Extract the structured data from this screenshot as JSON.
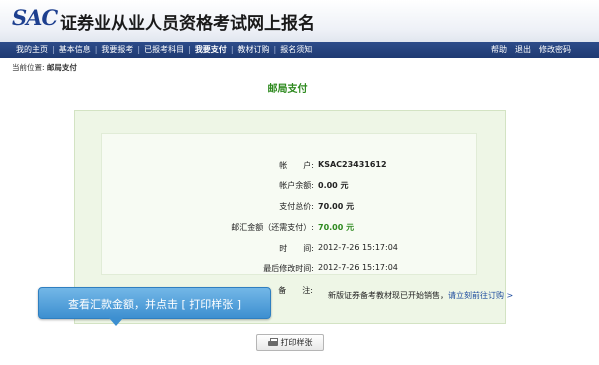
{
  "header": {
    "logo": "SAC",
    "title": "证券业从业人员资格考试网上报名"
  },
  "nav": {
    "left": [
      "我的主页",
      "基本信息",
      "我要报考",
      "已报考科目",
      "我要支付",
      "教材订购",
      "报名须知"
    ],
    "active_index": 4,
    "right": [
      "帮助",
      "退出",
      "修改密码"
    ]
  },
  "breadcrumb": {
    "label": "当前位置:",
    "current": "邮局支付"
  },
  "page_title": "邮局支付",
  "details": [
    {
      "label": "帐　　户:",
      "value": "KSAC23431612"
    },
    {
      "label": "帐户余额:",
      "value": "0.00 元"
    },
    {
      "label": "支付总价:",
      "value": "70.00 元"
    },
    {
      "label": "邮汇金额（还需支付）:",
      "value": "70.00 元"
    },
    {
      "label": "时　　间:",
      "value": "2012-7-26 15:17:04"
    },
    {
      "label": "最后修改时间:",
      "value": "2012-7-26 15:17:04"
    },
    {
      "label": "备　　注:",
      "value": ""
    }
  ],
  "notice": {
    "text": "新版证券备考教材现已开始销售，",
    "link": "请立刻前往订购 >"
  },
  "tooltip": "查看汇款金额，并点击 [ 打印样张 ]",
  "print_button": "打印样张"
}
